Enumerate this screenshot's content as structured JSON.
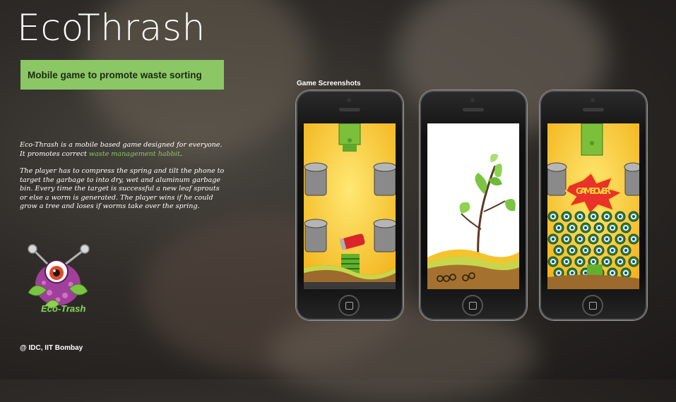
{
  "app": {
    "title": "EcoThrash",
    "tagline": "Mobile game to promote waste sorting"
  },
  "description": {
    "para1_before": "Eco-Thrash is a mobile based game designed for everyone. It promotes correct ",
    "para1_link": "waste management habbit",
    "para1_after": ".",
    "para2": "The player has to compress the spring and tilt the phone to target the garbage to into dry, wet and aluminum garbage bin. Every time the target is successful a new leaf sprouts or else a worm is generated. The player wins if he could grow a tree and loses if worms take over the spring."
  },
  "logo": {
    "text": "Eco-Trash"
  },
  "screenshots": {
    "label": "Game Screenshots",
    "phones": [
      {
        "name": "gameplay"
      },
      {
        "name": "tree-growing"
      },
      {
        "name": "game-over",
        "overlay_text": "GAME OVER"
      }
    ]
  },
  "footer": {
    "credit": "@ IDC, IIT Bombay"
  },
  "colors": {
    "accent_green": "#8cc765",
    "game_yellow": "#f6c928"
  }
}
